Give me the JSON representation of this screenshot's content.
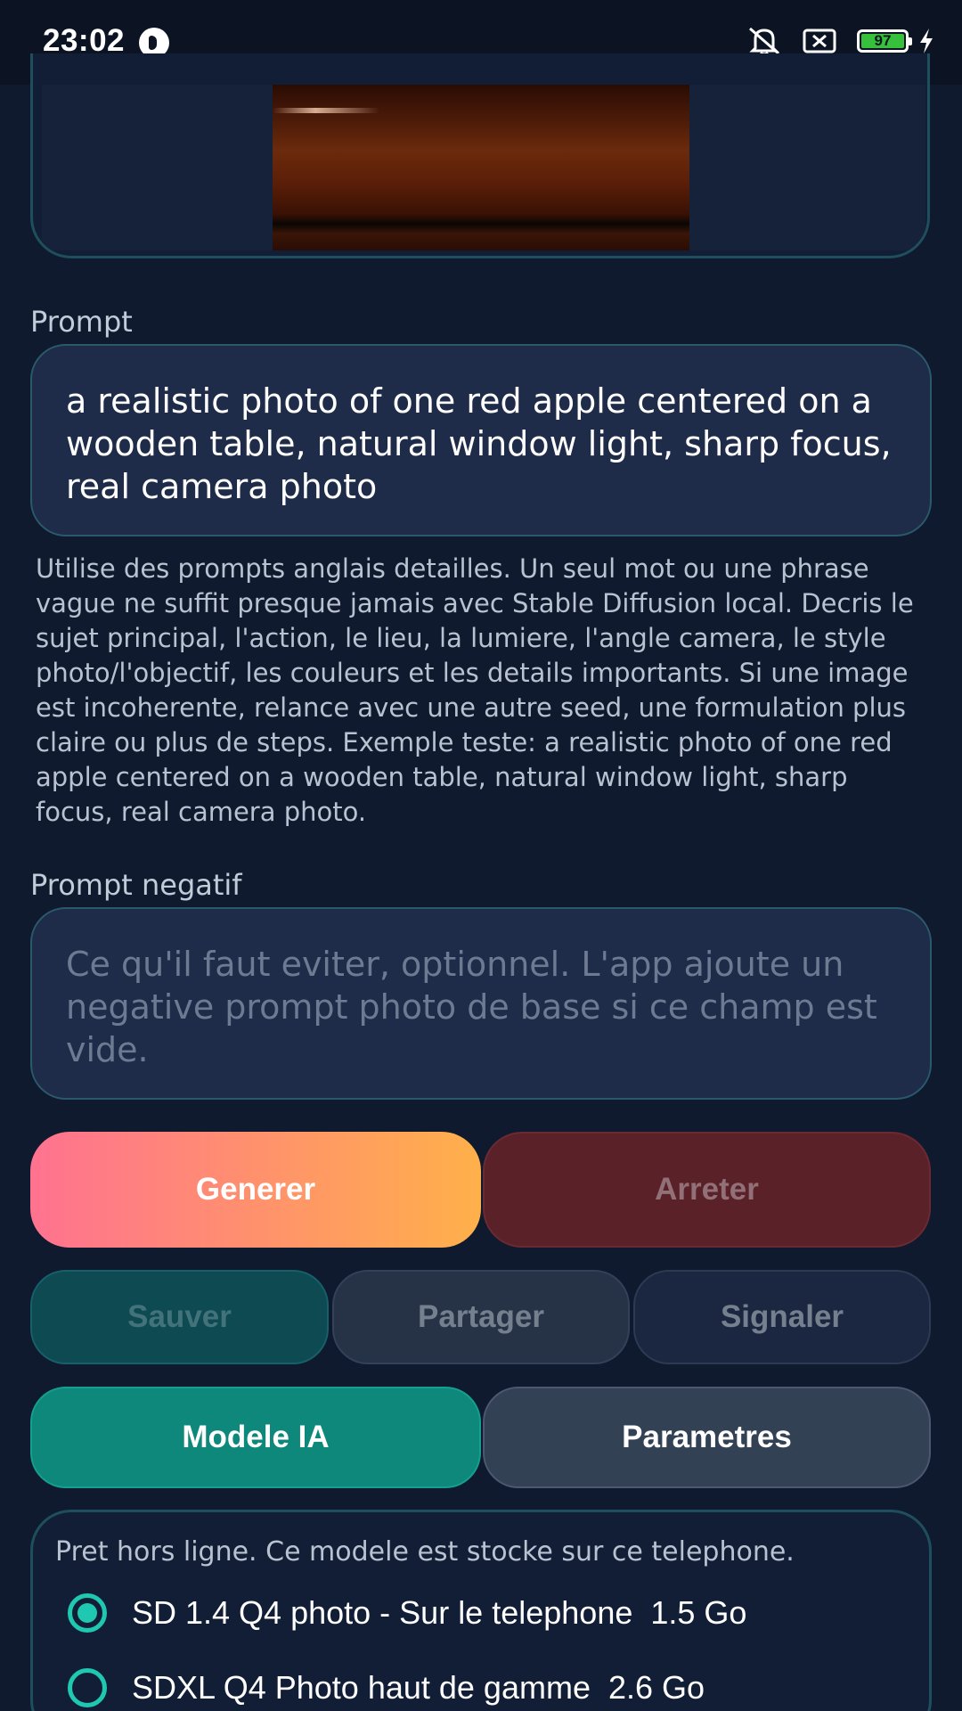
{
  "status_bar": {
    "time": "23:02",
    "battery_level": "97",
    "icons": [
      "media-icon",
      "mute-icon",
      "no-sim-icon",
      "battery-icon",
      "charging-icon"
    ]
  },
  "preview": {
    "image_description_icon": "generated-image"
  },
  "prompt": {
    "label": "Prompt",
    "value": "a realistic photo of one red apple centered on a wooden table, natural window light, sharp focus, real camera photo"
  },
  "hint": "Utilise des prompts anglais detailles. Un seul mot ou une phrase vague ne suffit presque jamais avec Stable Diffusion local. Decris le sujet principal, l'action, le lieu, la lumiere, l'angle camera, le style photo/l'objectif, les couleurs et les details importants. Si une image est incoherente, relance avec une autre seed, une formulation plus claire ou plus de steps. Exemple teste: a realistic photo of one red apple centered on a wooden table, natural window light, sharp focus, real camera photo.",
  "negative_prompt": {
    "label": "Prompt negatif",
    "placeholder": "Ce qu'il faut eviter, optionnel. L'app ajoute un negative prompt photo de base si ce champ est vide."
  },
  "actions": {
    "generate": "Generer",
    "stop": "Arreter",
    "save": "Sauver",
    "share": "Partager",
    "report": "Signaler",
    "model": "Modele IA",
    "settings": "Parametres"
  },
  "model_panel": {
    "status": "Pret hors ligne. Ce modele est stocke sur ce telephone.",
    "options": [
      {
        "label": "SD 1.4 Q4 photo - Sur le telephone  1.5 Go",
        "selected": true
      },
      {
        "label": "SDXL Q4 Photo haut de gamme  2.6 Go",
        "selected": false
      }
    ]
  },
  "colors": {
    "background": "#0f1a2e",
    "accent_teal": "#1fc8b0",
    "generate_gradient_start": "#ff7290",
    "generate_gradient_end": "#ffb04a",
    "stop_bg": "#5a2128"
  }
}
